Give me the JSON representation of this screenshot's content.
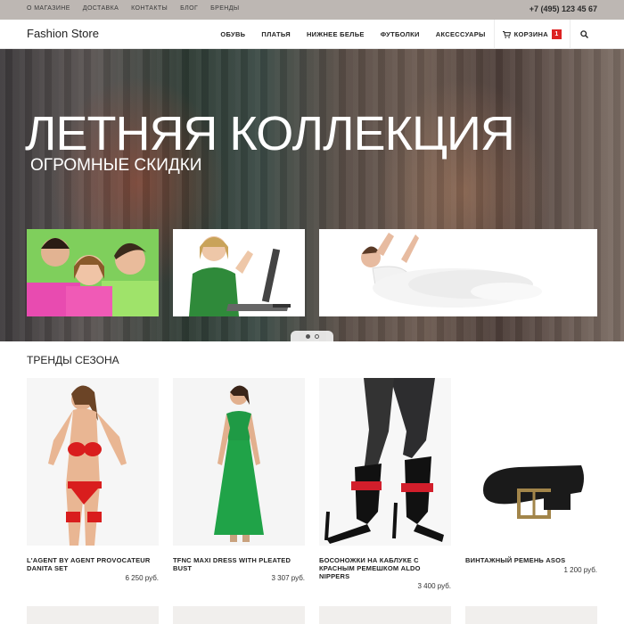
{
  "topbar": {
    "links": [
      "О МАГАЗИНЕ",
      "ДОСТАВКА",
      "КОНТАКТЫ",
      "БЛОГ",
      "БРЕНДЫ"
    ],
    "phone": "+7 (495) 123 45 67"
  },
  "header": {
    "logo": "Fashion Store",
    "nav": [
      "ОБУВЬ",
      "ПЛАТЬЯ",
      "НИЖНЕЕ БЕЛЬЕ",
      "ФУТБОЛКИ",
      "АКСЕССУАРЫ"
    ],
    "cart_label": "КОРЗИНА",
    "cart_count": "1",
    "icons": {
      "cart": "cart-icon",
      "search": "search-icon"
    }
  },
  "hero": {
    "title": "ЛЕТНЯЯ КОЛЛЕКЦИЯ",
    "subtitle": "ОГРОМНЫЕ СКИДКИ",
    "slides_total": 2,
    "active_slide": 1
  },
  "section": {
    "title": "ТРЕНДЫ СЕЗОНА",
    "products": [
      {
        "name": "L'AGENT BY AGENT PROVOCATEUR DANITA SET",
        "price": "6 250 руб."
      },
      {
        "name": "TFNC MAXI DRESS WITH PLEATED BUST",
        "price": "3 307 руб."
      },
      {
        "name": "БОСОНОЖКИ НА КАБЛУКЕ С КРАСНЫМ РЕМЕШКОМ ALDO NIPPERS",
        "price": "3 400 руб."
      },
      {
        "name": "ВИНТАЖНЫЙ РЕМЕНЬ ASOS",
        "price": "1 200 руб."
      }
    ]
  },
  "colors": {
    "accent": "#dd2222",
    "topbar": "#bdb7b3",
    "nav_text": "#222222"
  }
}
